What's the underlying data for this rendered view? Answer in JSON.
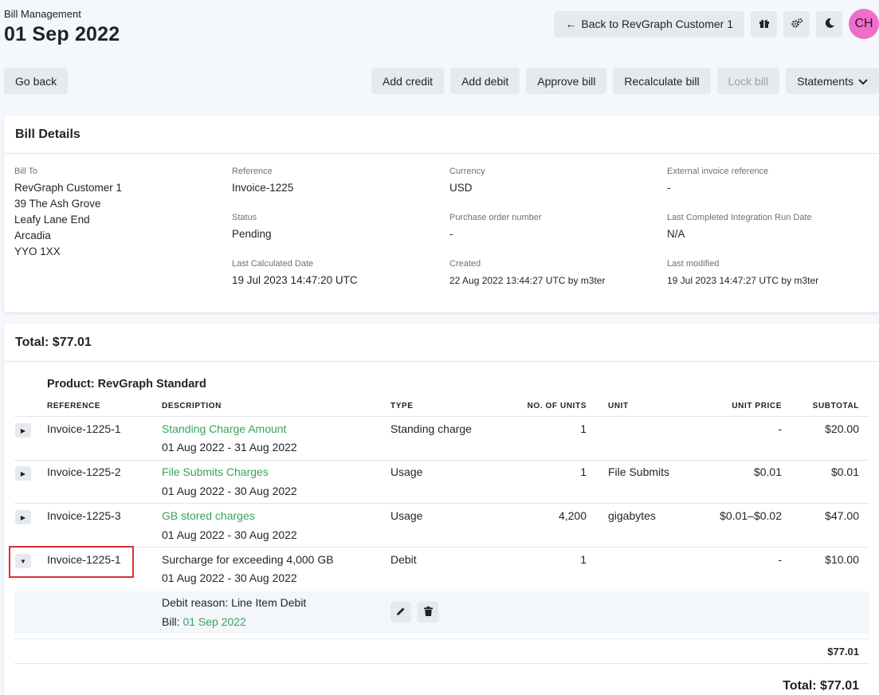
{
  "header": {
    "section": "Bill Management",
    "title": "01 Sep 2022",
    "back_label": "Back to RevGraph Customer 1",
    "avatar_initials": "CH"
  },
  "toolbar": {
    "go_back": "Go back",
    "add_credit": "Add credit",
    "add_debit": "Add debit",
    "approve": "Approve bill",
    "recalculate": "Recalculate bill",
    "lock": "Lock bill",
    "statements": "Statements"
  },
  "bill_details": {
    "title": "Bill Details",
    "bill_to_label": "Bill To",
    "customer": "RevGraph Customer 1",
    "address": [
      "39 The Ash Grove",
      "Leafy Lane End",
      "Arcadia",
      "YYO 1XX"
    ],
    "reference_label": "Reference",
    "reference": "Invoice-1225",
    "status_label": "Status",
    "status": "Pending",
    "last_calc_label": "Last Calculated Date",
    "last_calc": "19 Jul 2023 14:47:20 UTC",
    "currency_label": "Currency",
    "currency": "USD",
    "po_label": "Purchase order number",
    "po": "-",
    "created_label": "Created",
    "created": "22 Aug 2022 13:44:27 UTC by m3ter",
    "ext_ref_label": "External invoice reference",
    "ext_ref": "-",
    "integration_label": "Last Completed Integration Run Date",
    "integration": "N/A",
    "modified_label": "Last modified",
    "modified": "19 Jul 2023 14:47:27 UTC by m3ter"
  },
  "line_items": {
    "total_title": "Total: $77.01",
    "product": "Product: RevGraph Standard",
    "columns": [
      "REFERENCE",
      "DESCRIPTION",
      "TYPE",
      "NO. OF UNITS",
      "UNIT",
      "UNIT PRICE",
      "SUBTOTAL"
    ],
    "rows": [
      {
        "ref": "Invoice-1225-1",
        "desc": "Standing Charge Amount",
        "period": "01 Aug 2022 - 31 Aug 2022",
        "type": "Standing charge",
        "units": "1",
        "unit": "",
        "price": "-",
        "subtotal": "$20.00"
      },
      {
        "ref": "Invoice-1225-2",
        "desc": "File Submits Charges",
        "period": "01 Aug 2022 - 30 Aug 2022",
        "type": "Usage",
        "units": "1",
        "unit": "File Submits",
        "price": "$0.01",
        "subtotal": "$0.01"
      },
      {
        "ref": "Invoice-1225-3",
        "desc": "GB stored charges",
        "period": "01 Aug 2022 - 30 Aug 2022",
        "type": "Usage",
        "units": "4,200",
        "unit": "gigabytes",
        "price": "$0.01–$0.02",
        "subtotal": "$47.00"
      },
      {
        "ref": "Invoice-1225-1",
        "desc": "Surcharge for exceeding 4,000 GB",
        "period": "01 Aug 2022 - 30 Aug 2022",
        "type": "Debit",
        "units": "1",
        "unit": "",
        "price": "-",
        "subtotal": "$10.00"
      }
    ],
    "debit_reason": "Debit reason: Line Item Debit",
    "bill_prefix": "Bill: ",
    "bill_link": "01 Sep 2022",
    "product_subtotal": "$77.01",
    "grand_total": "Total: $77.01"
  }
}
